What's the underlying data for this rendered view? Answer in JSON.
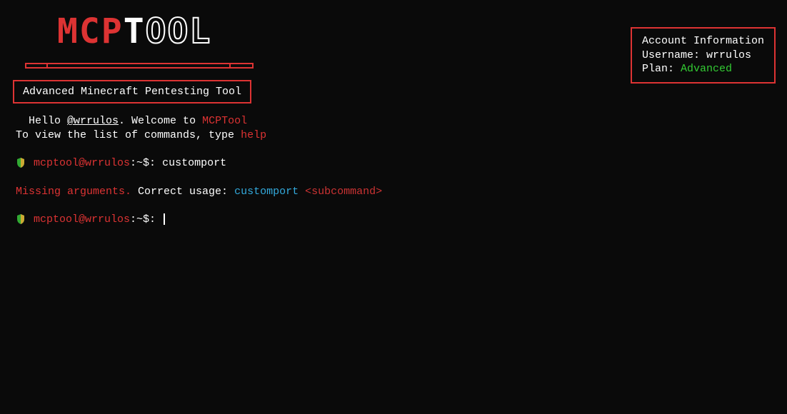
{
  "logo": {
    "part1": "MCP",
    "part2": "T",
    "part3": "OOL"
  },
  "subtitle": "Advanced Minecraft Pentesting Tool",
  "account": {
    "title": "Account Information",
    "username_label": "Username: ",
    "username_value": "wrrulos",
    "plan_label": "Plan: ",
    "plan_value": "Advanced"
  },
  "greeting": {
    "hello": "Hello ",
    "handle": "@wrrulos",
    "welcome": ". Welcome to ",
    "toolname": "MCPTool",
    "instruction": "To view the list of commands, type ",
    "help": "help"
  },
  "prompt": {
    "user": "mcptool@wrrulos",
    "sep": ":~$: "
  },
  "commands": {
    "entered": "customport"
  },
  "error": {
    "missing": "Missing arguments.",
    "correct": " Correct usage: ",
    "cmd": "customport ",
    "sub": "<subcommand>"
  }
}
